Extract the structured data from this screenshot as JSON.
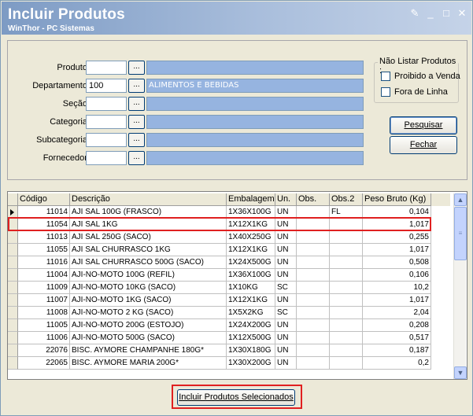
{
  "window": {
    "title": "Incluir Produtos",
    "subtitle": "WinThor - PC Sistemas"
  },
  "filters": {
    "rows": [
      {
        "label": "Produto:",
        "code": "",
        "desc": ""
      },
      {
        "label": "Departamento:",
        "code": "100",
        "desc": "ALIMENTOS E BEBIDAS"
      },
      {
        "label": "Seção:",
        "code": "",
        "desc": ""
      },
      {
        "label": "Categoria:",
        "code": "",
        "desc": ""
      },
      {
        "label": "Subcategoria:",
        "code": "",
        "desc": ""
      },
      {
        "label": "Fornecedor:",
        "code": "",
        "desc": ""
      }
    ],
    "lookup_label": "...",
    "group_title": "Não Listar Produtos :",
    "check_proibido": "Proibido a Venda",
    "check_fora": "Fora de Linha",
    "pesquisar_label": "Pesquisar",
    "fechar_label": "Fechar"
  },
  "grid": {
    "headers": [
      "Código",
      "Descrição",
      "Embalagem",
      "Un.",
      "Obs.",
      "Obs.2",
      "Peso Bruto (Kg)"
    ],
    "rows": [
      {
        "codigo": "11014",
        "descricao": "AJI SAL 100G (FRASCO)",
        "embalagem": "1X36X100G",
        "un": "UN",
        "obs": "",
        "obs2": "FL",
        "peso": "0,104"
      },
      {
        "codigo": "11054",
        "descricao": "AJI SAL 1KG",
        "embalagem": "1X12X1KG",
        "un": "UN",
        "obs": "",
        "obs2": "",
        "peso": "1,017"
      },
      {
        "codigo": "11013",
        "descricao": "AJI SAL 250G (SACO)",
        "embalagem": "1X40X250G",
        "un": "UN",
        "obs": "",
        "obs2": "",
        "peso": "0,255"
      },
      {
        "codigo": "11055",
        "descricao": "AJI SAL CHURRASCO 1KG",
        "embalagem": "1X12X1KG",
        "un": "UN",
        "obs": "",
        "obs2": "",
        "peso": "1,017"
      },
      {
        "codigo": "11016",
        "descricao": "AJI SAL CHURRASCO 500G (SACO)",
        "embalagem": "1X24X500G",
        "un": "UN",
        "obs": "",
        "obs2": "",
        "peso": "0,508"
      },
      {
        "codigo": "11004",
        "descricao": "AJI-NO-MOTO 100G (REFIL)",
        "embalagem": "1X36X100G",
        "un": "UN",
        "obs": "",
        "obs2": "",
        "peso": "0,106"
      },
      {
        "codigo": "11009",
        "descricao": "AJI-NO-MOTO 10KG (SACO)",
        "embalagem": "1X10KG",
        "un": "SC",
        "obs": "",
        "obs2": "",
        "peso": "10,2"
      },
      {
        "codigo": "11007",
        "descricao": "AJI-NO-MOTO 1KG (SACO)",
        "embalagem": "1X12X1KG",
        "un": "UN",
        "obs": "",
        "obs2": "",
        "peso": "1,017"
      },
      {
        "codigo": "11008",
        "descricao": "AJI-NO-MOTO 2 KG (SACO)",
        "embalagem": "1X5X2KG",
        "un": "SC",
        "obs": "",
        "obs2": "",
        "peso": "2,04"
      },
      {
        "codigo": "11005",
        "descricao": "AJI-NO-MOTO 200G (ESTOJO)",
        "embalagem": "1X24X200G",
        "un": "UN",
        "obs": "",
        "obs2": "",
        "peso": "0,208"
      },
      {
        "codigo": "11006",
        "descricao": "AJI-NO-MOTO 500G (SACO)",
        "embalagem": "1X12X500G",
        "un": "UN",
        "obs": "",
        "obs2": "",
        "peso": "0,517"
      },
      {
        "codigo": "22076",
        "descricao": "BISC. AYMORE CHAMPANHE 180G*",
        "embalagem": "1X30X180G",
        "un": "UN",
        "obs": "",
        "obs2": "",
        "peso": "0,187"
      },
      {
        "codigo": "22065",
        "descricao": "BISC. AYMORE MARIA 200G*",
        "embalagem": "1X30X200G",
        "un": "UN",
        "obs": "",
        "obs2": "",
        "peso": "0,2"
      }
    ]
  },
  "footer": {
    "incluir_label": "Incluir Produtos Selecionados"
  }
}
